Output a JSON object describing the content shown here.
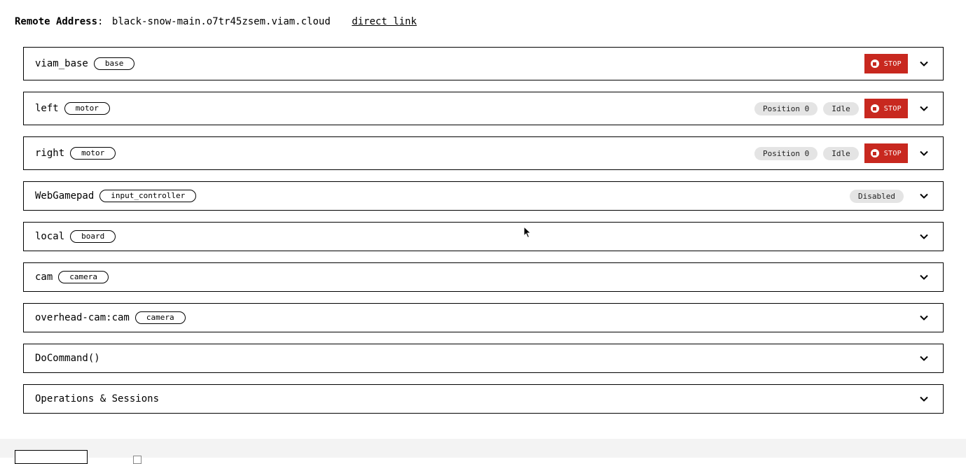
{
  "remote": {
    "label": "Remote Address",
    "colon": ":",
    "address": "black-snow-main.o7tr45zsem.viam.cloud",
    "link_label": "direct link"
  },
  "panels": [
    {
      "name": "viam_base",
      "type": "base",
      "stop_label": "STOP"
    },
    {
      "name": "left",
      "type": "motor",
      "position_label": "Position 0",
      "state_label": "Idle",
      "stop_label": "STOP"
    },
    {
      "name": "right",
      "type": "motor",
      "position_label": "Position 0",
      "state_label": "Idle",
      "stop_label": "STOP"
    },
    {
      "name": "WebGamepad",
      "type": "input_controller",
      "status_label": "Disabled"
    },
    {
      "name": "local",
      "type": "board"
    },
    {
      "name": "cam",
      "type": "camera"
    },
    {
      "name": "overhead-cam:cam",
      "type": "camera"
    },
    {
      "name": "DoCommand()"
    },
    {
      "name": "Operations & Sessions"
    }
  ],
  "icons": {
    "chevron": "chevron-down-icon",
    "stop": "stop-icon",
    "cursor": "mouse-cursor-icon"
  },
  "colors": {
    "stop_button": "#c8281f",
    "badge_bg": "#e4e4e4",
    "footer_bg": "#f3f3f3"
  }
}
